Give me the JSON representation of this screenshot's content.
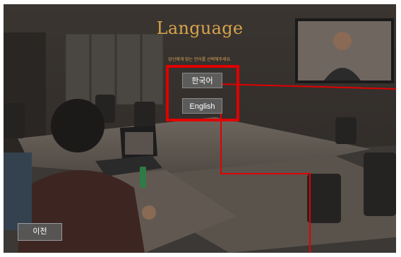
{
  "screen": {
    "title": "Language",
    "subtitle": "당신에게 맞는 언어를 선택해주세요."
  },
  "languages": [
    {
      "label": "한국어"
    },
    {
      "label": "English"
    }
  ],
  "navigation": {
    "back_label": "이전"
  },
  "colors": {
    "title": "#d9a34d",
    "highlight": "#e00000",
    "button": "#5f5f5f"
  }
}
